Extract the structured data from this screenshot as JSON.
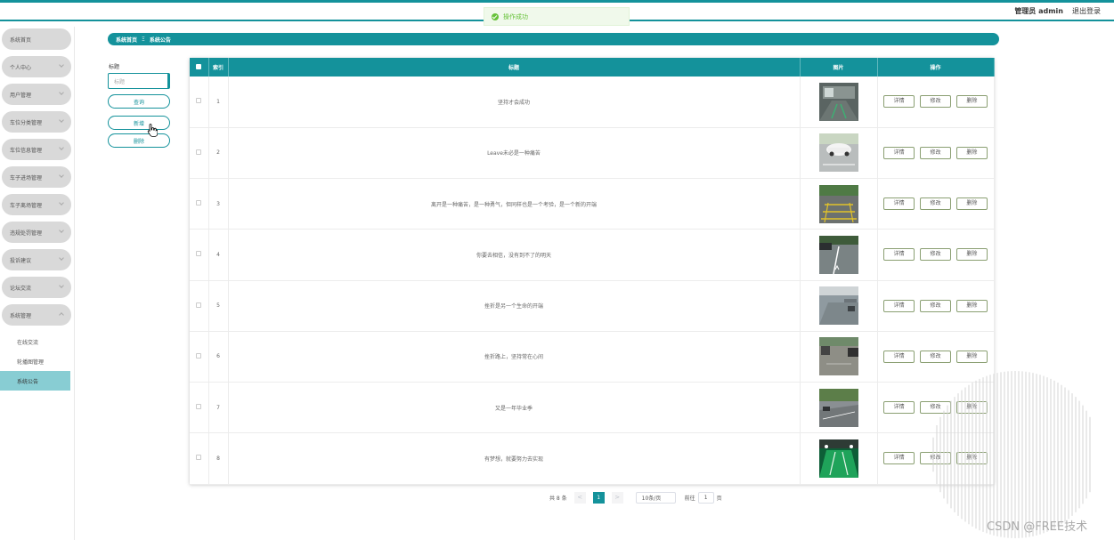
{
  "header": {
    "toast": "操作成功",
    "user": "管理员 admin",
    "logout": "退出登录"
  },
  "sidebar": {
    "items": [
      {
        "label": "系统首页",
        "chevron": false
      },
      {
        "label": "个人中心",
        "chevron": true
      },
      {
        "label": "用户管理",
        "chevron": true
      },
      {
        "label": "车位分类管理",
        "chevron": true
      },
      {
        "label": "车位信息管理",
        "chevron": true
      },
      {
        "label": "车子进场管理",
        "chevron": true
      },
      {
        "label": "车子离场管理",
        "chevron": true
      },
      {
        "label": "违规处罚管理",
        "chevron": true
      },
      {
        "label": "投诉建议",
        "chevron": true
      },
      {
        "label": "论坛交流",
        "chevron": true
      },
      {
        "label": "系统管理",
        "chevron": true
      }
    ],
    "sub_items": [
      "在线交流",
      "轮播图管理",
      "系统公告"
    ]
  },
  "breadcrumb": {
    "home": "系统首页",
    "separator": "Ξ",
    "current": "系统公告"
  },
  "filter": {
    "label": "标题",
    "placeholder": "标题",
    "query": "查询",
    "add": "新增",
    "delete": "删除"
  },
  "table": {
    "headers": [
      "索引",
      "标题",
      "图片",
      "操作"
    ],
    "actions": [
      "详情",
      "修改",
      "删除"
    ],
    "rows": [
      {
        "index": "1",
        "title": "坚持才会成功",
        "img": "garage"
      },
      {
        "index": "2",
        "title": "Leave未必是一种痛苦",
        "img": "white-car"
      },
      {
        "index": "3",
        "title": "离开是一种痛苦，是一种勇气，但同样也是一个考验，是一个新的开端",
        "img": "yellow-lines"
      },
      {
        "index": "4",
        "title": "你要去相信，没有到不了的明天",
        "img": "road-lane"
      },
      {
        "index": "5",
        "title": "挫折是另一个生命的开端",
        "img": "underground"
      },
      {
        "index": "6",
        "title": "挫折路上，坚持常在心间",
        "img": "outdoor-lot"
      },
      {
        "index": "7",
        "title": "又是一年毕业季",
        "img": "street"
      },
      {
        "index": "8",
        "title": "有梦想，就要努力去实现",
        "img": "green-floor"
      }
    ]
  },
  "pager": {
    "total": "共 8 条",
    "prev": "<",
    "page": "1",
    "next": ">",
    "size": "10条/页",
    "goto": "前往",
    "goto_value": "1",
    "page_unit": "页"
  },
  "watermark": "CSDN @FREE技术"
}
